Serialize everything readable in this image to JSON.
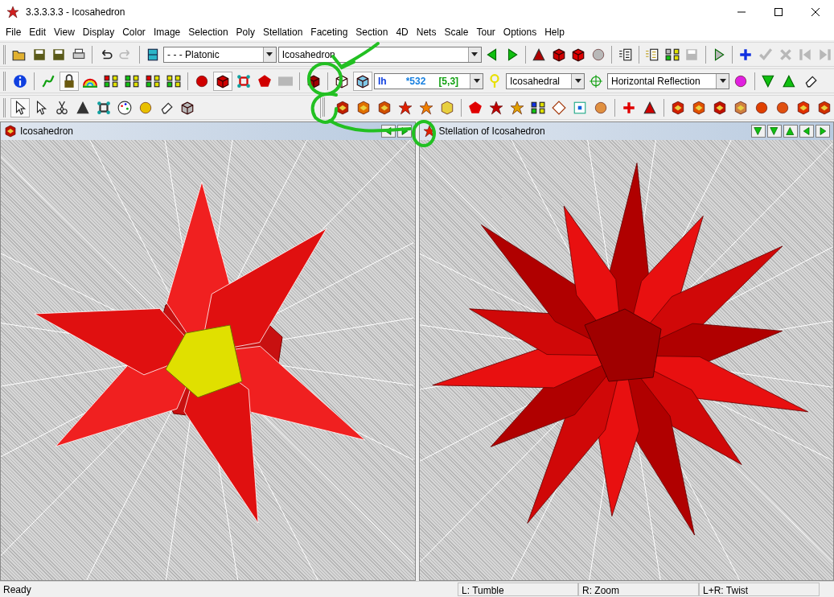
{
  "window": {
    "title": "3.3.3.3.3 - Icosahedron"
  },
  "menu": [
    "File",
    "Edit",
    "View",
    "Display",
    "Color",
    "Image",
    "Selection",
    "Poly",
    "Stellation",
    "Faceting",
    "Section",
    "4D",
    "Nets",
    "Scale",
    "Tour",
    "Options",
    "Help"
  ],
  "toolbar_1": [
    {
      "kind": "button",
      "disabled": false,
      "pressed": false
    },
    {
      "kind": "button",
      "disabled": false,
      "pressed": false
    },
    {
      "kind": "button",
      "disabled": false,
      "pressed": false
    },
    {
      "kind": "button",
      "disabled": false,
      "pressed": false
    },
    {
      "kind": "separator"
    },
    {
      "kind": "button",
      "disabled": false,
      "pressed": false
    },
    {
      "kind": "button",
      "disabled": true,
      "pressed": false
    },
    {
      "kind": "separator"
    },
    {
      "kind": "button",
      "disabled": false,
      "pressed": false
    },
    {
      "kind": "combo",
      "value": "- - - Platonic"
    },
    {
      "kind": "combo",
      "value": "Icosahedron"
    },
    {
      "kind": "button",
      "disabled": false,
      "pressed": false
    },
    {
      "kind": "button",
      "disabled": false,
      "pressed": false
    },
    {
      "kind": "separator"
    },
    {
      "kind": "button",
      "disabled": false,
      "pressed": false
    },
    {
      "kind": "button",
      "disabled": false,
      "pressed": false
    },
    {
      "kind": "button",
      "disabled": false,
      "pressed": false
    },
    {
      "kind": "button",
      "disabled": true,
      "pressed": false
    },
    {
      "kind": "separator"
    },
    {
      "kind": "button",
      "disabled": false,
      "pressed": false
    },
    {
      "kind": "separator"
    },
    {
      "kind": "button",
      "disabled": false,
      "pressed": false
    },
    {
      "kind": "button",
      "disabled": true,
      "pressed": false
    },
    {
      "kind": "button",
      "disabled": true,
      "pressed": false
    },
    {
      "kind": "separator"
    },
    {
      "kind": "button",
      "disabled": true,
      "pressed": false
    },
    {
      "kind": "separator"
    },
    {
      "kind": "button",
      "disabled": false,
      "pressed": false
    },
    {
      "kind": "button",
      "disabled": true,
      "pressed": false
    },
    {
      "kind": "button",
      "disabled": true,
      "pressed": false
    },
    {
      "kind": "button",
      "disabled": true,
      "pressed": false
    },
    {
      "kind": "button",
      "disabled": true,
      "pressed": false
    }
  ],
  "toolbar_2": [
    {
      "kind": "button",
      "disabled": false,
      "pressed": false
    },
    {
      "kind": "separator"
    },
    {
      "kind": "button",
      "disabled": false,
      "pressed": false
    },
    {
      "kind": "button",
      "disabled": false,
      "pressed": true
    },
    {
      "kind": "button",
      "disabled": false,
      "pressed": false
    },
    {
      "kind": "button",
      "disabled": false,
      "pressed": false
    },
    {
      "kind": "button",
      "disabled": false,
      "pressed": false
    },
    {
      "kind": "button",
      "disabled": false,
      "pressed": false
    },
    {
      "kind": "button",
      "disabled": false,
      "pressed": false
    },
    {
      "kind": "separator"
    },
    {
      "kind": "button",
      "disabled": false,
      "pressed": false
    },
    {
      "kind": "button",
      "disabled": false,
      "pressed": true
    },
    {
      "kind": "button",
      "disabled": false,
      "pressed": false
    },
    {
      "kind": "button",
      "disabled": false,
      "pressed": false
    },
    {
      "kind": "button",
      "disabled": true,
      "pressed": false
    },
    {
      "kind": "separator"
    },
    {
      "kind": "button",
      "disabled": false,
      "pressed": false
    },
    {
      "kind": "separator"
    },
    {
      "kind": "button",
      "disabled": false,
      "pressed": false
    },
    {
      "kind": "button",
      "disabled": false,
      "pressed": true
    },
    {
      "kind": "symmetry",
      "schoenflies": "Ih",
      "orbifold": "*532",
      "coxeter": "[5,3]"
    },
    {
      "kind": "button",
      "disabled": false,
      "pressed": false
    },
    {
      "kind": "combo",
      "value": "Icosahedral"
    },
    {
      "kind": "button",
      "disabled": false,
      "pressed": false
    },
    {
      "kind": "combo",
      "value": "Horizontal Reflection"
    },
    {
      "kind": "button",
      "disabled": false,
      "pressed": false
    },
    {
      "kind": "separator"
    },
    {
      "kind": "button",
      "disabled": false,
      "pressed": false
    },
    {
      "kind": "button",
      "disabled": false,
      "pressed": false
    },
    {
      "kind": "button",
      "disabled": false,
      "pressed": false
    }
  ],
  "toolbar_3": [
    {
      "kind": "button",
      "disabled": false,
      "pressed": true
    },
    {
      "kind": "button",
      "disabled": false,
      "pressed": false
    },
    {
      "kind": "button",
      "disabled": false,
      "pressed": false
    },
    {
      "kind": "button",
      "disabled": false,
      "pressed": false
    },
    {
      "kind": "button",
      "disabled": false,
      "pressed": false
    },
    {
      "kind": "button",
      "disabled": false,
      "pressed": false
    },
    {
      "kind": "button",
      "disabled": false,
      "pressed": false
    },
    {
      "kind": "button",
      "disabled": false,
      "pressed": false
    },
    {
      "kind": "button",
      "disabled": true,
      "pressed": false
    },
    {
      "kind": "band"
    },
    {
      "kind": "button",
      "disabled": false,
      "pressed": false
    },
    {
      "kind": "button",
      "disabled": false,
      "pressed": false
    },
    {
      "kind": "button",
      "disabled": false,
      "pressed": false
    },
    {
      "kind": "button",
      "disabled": false,
      "pressed": false
    },
    {
      "kind": "button",
      "disabled": false,
      "pressed": false
    },
    {
      "kind": "button",
      "disabled": false,
      "pressed": false
    },
    {
      "kind": "separator"
    },
    {
      "kind": "button",
      "disabled": false,
      "pressed": false
    },
    {
      "kind": "button",
      "disabled": false,
      "pressed": false
    },
    {
      "kind": "button",
      "disabled": false,
      "pressed": false
    },
    {
      "kind": "button",
      "disabled": false,
      "pressed": false
    },
    {
      "kind": "button",
      "disabled": false,
      "pressed": false
    },
    {
      "kind": "button",
      "disabled": false,
      "pressed": false
    },
    {
      "kind": "button",
      "disabled": false,
      "pressed": false
    },
    {
      "kind": "separator"
    },
    {
      "kind": "button",
      "disabled": false,
      "pressed": false
    },
    {
      "kind": "button",
      "disabled": false,
      "pressed": false
    },
    {
      "kind": "separator"
    },
    {
      "kind": "button",
      "disabled": false,
      "pressed": false
    },
    {
      "kind": "button",
      "disabled": false,
      "pressed": false
    },
    {
      "kind": "button",
      "disabled": false,
      "pressed": false
    },
    {
      "kind": "button",
      "disabled": false,
      "pressed": false
    },
    {
      "kind": "button",
      "disabled": false,
      "pressed": false
    },
    {
      "kind": "button",
      "disabled": false,
      "pressed": false
    },
    {
      "kind": "button",
      "disabled": false,
      "pressed": false
    },
    {
      "kind": "button",
      "disabled": false,
      "pressed": false
    }
  ],
  "panes": [
    {
      "title": "Icosahedron",
      "kind": "original"
    },
    {
      "title": "Stellation of Icosahedron",
      "kind": "stellation"
    }
  ],
  "status_bar": [
    "Ready",
    "L: Tumble",
    "R: Zoom",
    "L+R: Twist"
  ]
}
